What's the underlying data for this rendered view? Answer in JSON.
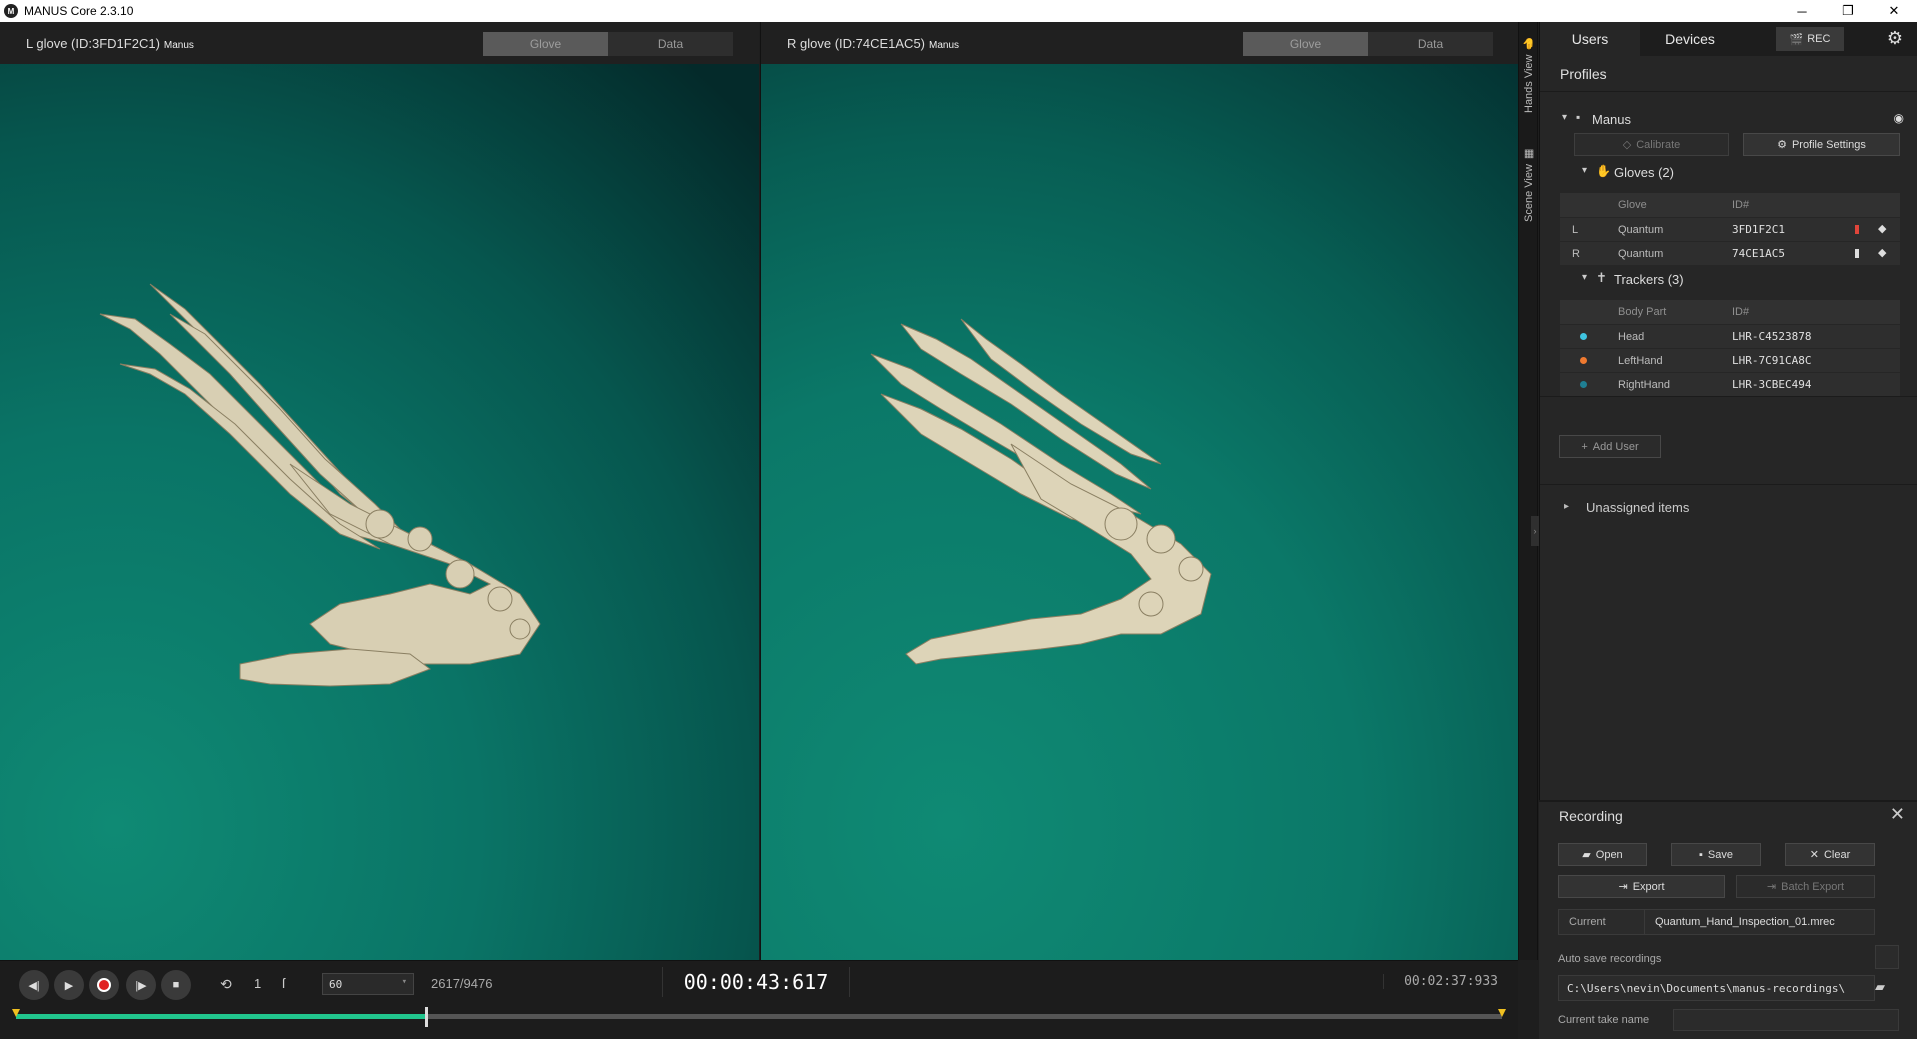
{
  "window": {
    "title": "MANUS Core 2.3.10",
    "logo_text": "M",
    "minimize": "─",
    "restore": "❐",
    "close": "✕"
  },
  "viewports": {
    "left": {
      "title": "L glove (ID:3FD1F2C1)",
      "subtitle": "Manus",
      "tab_glove": "Glove",
      "tab_data": "Data"
    },
    "right": {
      "title": "R glove (ID:74CE1AC5)",
      "subtitle": "Manus",
      "tab_glove": "Glove",
      "tab_data": "Data"
    }
  },
  "sidetabs": {
    "hands_view": "Hands View",
    "scene_view": "Scene View"
  },
  "panel": {
    "tabs": {
      "users": "Users",
      "devices": "Devices",
      "rec": "REC"
    },
    "profiles_title": "Profiles",
    "profile": {
      "name": "Manus",
      "calibrate": "Calibrate",
      "profile_settings": "Profile Settings",
      "gloves_title": "Gloves (2)",
      "gloves_header": {
        "glove": "Glove",
        "id": "ID#"
      },
      "gloves": [
        {
          "side": "L",
          "type": "Quantum",
          "id": "3FD1F2C1",
          "battery_color": "#e0453a"
        },
        {
          "side": "R",
          "type": "Quantum",
          "id": "74CE1AC5",
          "battery_color": "#dddddd"
        }
      ],
      "trackers_title": "Trackers (3)",
      "trackers_header": {
        "body_part": "Body Part",
        "id": "ID#"
      },
      "trackers": [
        {
          "part": "Head",
          "id": "LHR-C4523878",
          "color": "#3fc4e0"
        },
        {
          "part": "LeftHand",
          "id": "LHR-7C91CA8C",
          "color": "#f07a30"
        },
        {
          "part": "RightHand",
          "id": "LHR-3CBEC494",
          "color": "#1f7f93"
        }
      ]
    },
    "add_user": "Add User",
    "unassigned": "Unassigned items"
  },
  "recording": {
    "title": "Recording",
    "open": "Open",
    "save": "Save",
    "clear": "Clear",
    "export": "Export",
    "batch_export": "Batch Export",
    "current_label": "Current",
    "current_value": "Quantum_Hand_Inspection_01.mrec",
    "autosave_label": "Auto save recordings",
    "autosave_path": "C:\\Users\\nevin\\Documents\\manus-recordings\\",
    "take_name_label": "Current take name",
    "take_name_value": ""
  },
  "transport": {
    "fps": "60",
    "loop_count": "1",
    "frames": "2617/9476",
    "timecode": "00:00:43:617",
    "duration": "00:02:37:933",
    "progress": 0.276
  },
  "colors": {
    "accent": "#21c58d",
    "rec_red": "#e02020",
    "marker": "#f0c020"
  }
}
